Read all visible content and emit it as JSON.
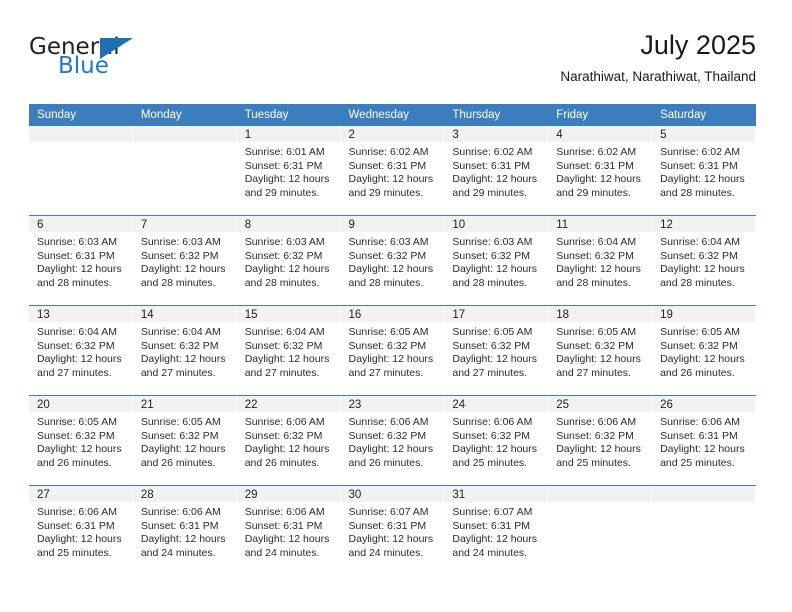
{
  "brand": {
    "name_top": "General",
    "name_bottom": "Blue",
    "triangle_icon": "brand-triangle-icon",
    "colors": {
      "blue": "#1f7ac4",
      "dark": "#231f20"
    }
  },
  "header": {
    "title": "July 2025",
    "subtitle": "Narathiwat, Narathiwat, Thailand"
  },
  "theme": {
    "header_blue": "#3b7dbf",
    "daynum_band": "#f2f2f2",
    "text": "#222222"
  },
  "calendar": {
    "weekday_headers": [
      "Sunday",
      "Monday",
      "Tuesday",
      "Wednesday",
      "Thursday",
      "Friday",
      "Saturday"
    ],
    "weeks": [
      [
        {
          "day": "",
          "empty": true
        },
        {
          "day": "",
          "empty": true
        },
        {
          "day": "1",
          "sunrise": "Sunrise: 6:01 AM",
          "sunset": "Sunset: 6:31 PM",
          "daylight_1": "Daylight: 12 hours",
          "daylight_2": "and 29 minutes."
        },
        {
          "day": "2",
          "sunrise": "Sunrise: 6:02 AM",
          "sunset": "Sunset: 6:31 PM",
          "daylight_1": "Daylight: 12 hours",
          "daylight_2": "and 29 minutes."
        },
        {
          "day": "3",
          "sunrise": "Sunrise: 6:02 AM",
          "sunset": "Sunset: 6:31 PM",
          "daylight_1": "Daylight: 12 hours",
          "daylight_2": "and 29 minutes."
        },
        {
          "day": "4",
          "sunrise": "Sunrise: 6:02 AM",
          "sunset": "Sunset: 6:31 PM",
          "daylight_1": "Daylight: 12 hours",
          "daylight_2": "and 29 minutes."
        },
        {
          "day": "5",
          "sunrise": "Sunrise: 6:02 AM",
          "sunset": "Sunset: 6:31 PM",
          "daylight_1": "Daylight: 12 hours",
          "daylight_2": "and 28 minutes."
        }
      ],
      [
        {
          "day": "6",
          "sunrise": "Sunrise: 6:03 AM",
          "sunset": "Sunset: 6:31 PM",
          "daylight_1": "Daylight: 12 hours",
          "daylight_2": "and 28 minutes."
        },
        {
          "day": "7",
          "sunrise": "Sunrise: 6:03 AM",
          "sunset": "Sunset: 6:32 PM",
          "daylight_1": "Daylight: 12 hours",
          "daylight_2": "and 28 minutes."
        },
        {
          "day": "8",
          "sunrise": "Sunrise: 6:03 AM",
          "sunset": "Sunset: 6:32 PM",
          "daylight_1": "Daylight: 12 hours",
          "daylight_2": "and 28 minutes."
        },
        {
          "day": "9",
          "sunrise": "Sunrise: 6:03 AM",
          "sunset": "Sunset: 6:32 PM",
          "daylight_1": "Daylight: 12 hours",
          "daylight_2": "and 28 minutes."
        },
        {
          "day": "10",
          "sunrise": "Sunrise: 6:03 AM",
          "sunset": "Sunset: 6:32 PM",
          "daylight_1": "Daylight: 12 hours",
          "daylight_2": "and 28 minutes."
        },
        {
          "day": "11",
          "sunrise": "Sunrise: 6:04 AM",
          "sunset": "Sunset: 6:32 PM",
          "daylight_1": "Daylight: 12 hours",
          "daylight_2": "and 28 minutes."
        },
        {
          "day": "12",
          "sunrise": "Sunrise: 6:04 AM",
          "sunset": "Sunset: 6:32 PM",
          "daylight_1": "Daylight: 12 hours",
          "daylight_2": "and 28 minutes."
        }
      ],
      [
        {
          "day": "13",
          "sunrise": "Sunrise: 6:04 AM",
          "sunset": "Sunset: 6:32 PM",
          "daylight_1": "Daylight: 12 hours",
          "daylight_2": "and 27 minutes."
        },
        {
          "day": "14",
          "sunrise": "Sunrise: 6:04 AM",
          "sunset": "Sunset: 6:32 PM",
          "daylight_1": "Daylight: 12 hours",
          "daylight_2": "and 27 minutes."
        },
        {
          "day": "15",
          "sunrise": "Sunrise: 6:04 AM",
          "sunset": "Sunset: 6:32 PM",
          "daylight_1": "Daylight: 12 hours",
          "daylight_2": "and 27 minutes."
        },
        {
          "day": "16",
          "sunrise": "Sunrise: 6:05 AM",
          "sunset": "Sunset: 6:32 PM",
          "daylight_1": "Daylight: 12 hours",
          "daylight_2": "and 27 minutes."
        },
        {
          "day": "17",
          "sunrise": "Sunrise: 6:05 AM",
          "sunset": "Sunset: 6:32 PM",
          "daylight_1": "Daylight: 12 hours",
          "daylight_2": "and 27 minutes."
        },
        {
          "day": "18",
          "sunrise": "Sunrise: 6:05 AM",
          "sunset": "Sunset: 6:32 PM",
          "daylight_1": "Daylight: 12 hours",
          "daylight_2": "and 27 minutes."
        },
        {
          "day": "19",
          "sunrise": "Sunrise: 6:05 AM",
          "sunset": "Sunset: 6:32 PM",
          "daylight_1": "Daylight: 12 hours",
          "daylight_2": "and 26 minutes."
        }
      ],
      [
        {
          "day": "20",
          "sunrise": "Sunrise: 6:05 AM",
          "sunset": "Sunset: 6:32 PM",
          "daylight_1": "Daylight: 12 hours",
          "daylight_2": "and 26 minutes."
        },
        {
          "day": "21",
          "sunrise": "Sunrise: 6:05 AM",
          "sunset": "Sunset: 6:32 PM",
          "daylight_1": "Daylight: 12 hours",
          "daylight_2": "and 26 minutes."
        },
        {
          "day": "22",
          "sunrise": "Sunrise: 6:06 AM",
          "sunset": "Sunset: 6:32 PM",
          "daylight_1": "Daylight: 12 hours",
          "daylight_2": "and 26 minutes."
        },
        {
          "day": "23",
          "sunrise": "Sunrise: 6:06 AM",
          "sunset": "Sunset: 6:32 PM",
          "daylight_1": "Daylight: 12 hours",
          "daylight_2": "and 26 minutes."
        },
        {
          "day": "24",
          "sunrise": "Sunrise: 6:06 AM",
          "sunset": "Sunset: 6:32 PM",
          "daylight_1": "Daylight: 12 hours",
          "daylight_2": "and 25 minutes."
        },
        {
          "day": "25",
          "sunrise": "Sunrise: 6:06 AM",
          "sunset": "Sunset: 6:32 PM",
          "daylight_1": "Daylight: 12 hours",
          "daylight_2": "and 25 minutes."
        },
        {
          "day": "26",
          "sunrise": "Sunrise: 6:06 AM",
          "sunset": "Sunset: 6:31 PM",
          "daylight_1": "Daylight: 12 hours",
          "daylight_2": "and 25 minutes."
        }
      ],
      [
        {
          "day": "27",
          "sunrise": "Sunrise: 6:06 AM",
          "sunset": "Sunset: 6:31 PM",
          "daylight_1": "Daylight: 12 hours",
          "daylight_2": "and 25 minutes."
        },
        {
          "day": "28",
          "sunrise": "Sunrise: 6:06 AM",
          "sunset": "Sunset: 6:31 PM",
          "daylight_1": "Daylight: 12 hours",
          "daylight_2": "and 24 minutes."
        },
        {
          "day": "29",
          "sunrise": "Sunrise: 6:06 AM",
          "sunset": "Sunset: 6:31 PM",
          "daylight_1": "Daylight: 12 hours",
          "daylight_2": "and 24 minutes."
        },
        {
          "day": "30",
          "sunrise": "Sunrise: 6:07 AM",
          "sunset": "Sunset: 6:31 PM",
          "daylight_1": "Daylight: 12 hours",
          "daylight_2": "and 24 minutes."
        },
        {
          "day": "31",
          "sunrise": "Sunrise: 6:07 AM",
          "sunset": "Sunset: 6:31 PM",
          "daylight_1": "Daylight: 12 hours",
          "daylight_2": "and 24 minutes."
        },
        {
          "day": "",
          "empty": true
        },
        {
          "day": "",
          "empty": true
        }
      ]
    ]
  }
}
